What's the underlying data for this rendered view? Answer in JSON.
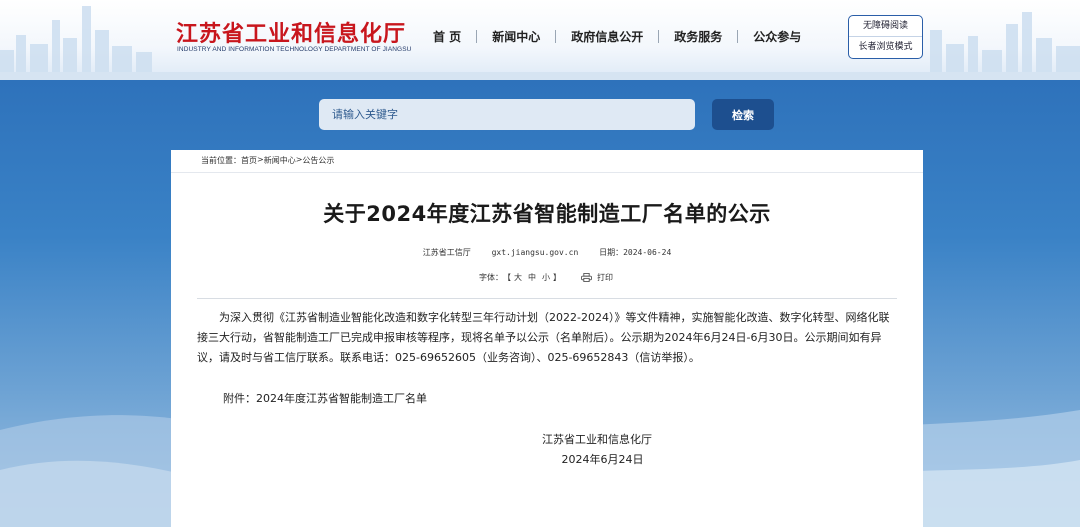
{
  "header": {
    "logo_cn": "江苏省工业和信息化厅",
    "logo_en": "INDUSTRY AND INFORMATION TECHNOLOGY DEPARTMENT OF JIANGSU",
    "nav": [
      "首 页",
      "新闻中心",
      "政府信息公开",
      "政务服务",
      "公众参与"
    ],
    "accessibility": {
      "barrier_free": "无障碍阅读",
      "elder_mode": "长者浏览模式"
    }
  },
  "search": {
    "placeholder": "请输入关键字",
    "button": "检索"
  },
  "breadcrumb": {
    "prefix": "当前位置：",
    "items": [
      "首页",
      "新闻中心",
      "公告公示"
    ],
    "separator": ">"
  },
  "article": {
    "title": "关于2024年度江苏省智能制造工厂名单的公示",
    "source": "江苏省工信厅",
    "site": "gxt.jiangsu.gov.cn",
    "date_label": "日期：",
    "date": "2024-06-24",
    "font_label": "字体：",
    "font_open": "【",
    "font_sizes": [
      "大",
      "中",
      "小"
    ],
    "font_close": "】",
    "print_label": "打印",
    "body": "为深入贯彻《江苏省制造业智能化改造和数字化转型三年行动计划（2022-2024）》等文件精神，实施智能化改造、数字化转型、网络化联接三大行动，省智能制造工厂已完成申报审核等程序，现将名单予以公示（名单附后）。公示期为2024年6月24日-6月30日。公示期间如有异议，请及时与省工信厅联系。联系电话：025-69652605（业务咨询）、025-69652843（信访举报）。",
    "attachment_label": "附件：",
    "attachment_name": "2024年度江苏省智能制造工厂名单",
    "signature_org": "江苏省工业和信息化厅",
    "signature_date": "2024年6月24日"
  },
  "colors": {
    "logo_red": "#c8161d",
    "hero_blue": "#2e72bb",
    "search_button": "#1d4f8f"
  }
}
